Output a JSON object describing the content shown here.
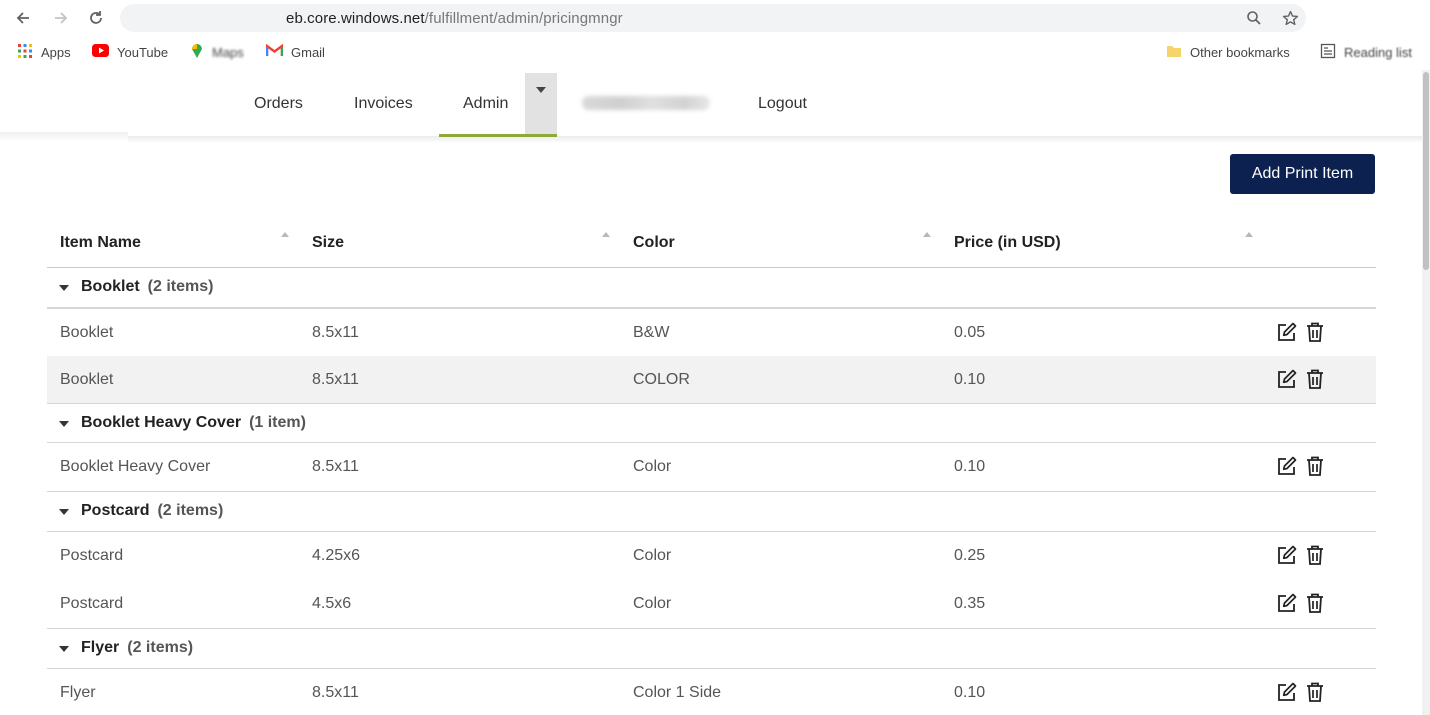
{
  "browser": {
    "url_host": "eb.core.windows.net",
    "url_path": "/fulfillment/admin/pricingmngr",
    "bookmarks": [
      {
        "label": "Apps",
        "icon": "apps-grid-icon"
      },
      {
        "label": "YouTube",
        "icon": "youtube-icon"
      },
      {
        "label": "Maps",
        "icon": "maps-icon"
      },
      {
        "label": "Gmail",
        "icon": "gmail-icon"
      }
    ],
    "other_bookmarks": "Other bookmarks",
    "reading_list": "Reading list"
  },
  "nav": {
    "orders": "Orders",
    "invoices": "Invoices",
    "admin": "Admin",
    "logout": "Logout",
    "accent_color": "#8fa83a"
  },
  "toolbar": {
    "add_label": "Add Print Item",
    "button_color": "#0d2150"
  },
  "table": {
    "columns": [
      "Item Name",
      "Size",
      "Color",
      "Price (in USD)"
    ],
    "groups": [
      {
        "name": "Booklet",
        "count": "(2 items)",
        "rows": [
          {
            "name": "Booklet",
            "size": "8.5x11",
            "color": "B&W",
            "price": "0.05"
          },
          {
            "name": "Booklet",
            "size": "8.5x11",
            "color": "COLOR",
            "price": "0.10"
          }
        ]
      },
      {
        "name": "Booklet Heavy Cover",
        "count": "(1 item)",
        "rows": [
          {
            "name": "Booklet Heavy Cover",
            "size": "8.5x11",
            "color": "Color",
            "price": "0.10"
          }
        ]
      },
      {
        "name": "Postcard",
        "count": "(2 items)",
        "rows": [
          {
            "name": "Postcard",
            "size": "4.25x6",
            "color": "Color",
            "price": "0.25"
          },
          {
            "name": "Postcard",
            "size": "4.5x6",
            "color": "Color",
            "price": "0.35"
          }
        ]
      },
      {
        "name": "Flyer",
        "count": "(2 items)",
        "rows": [
          {
            "name": "Flyer",
            "size": "8.5x11",
            "color": "Color 1 Side",
            "price": "0.10"
          }
        ]
      }
    ]
  }
}
